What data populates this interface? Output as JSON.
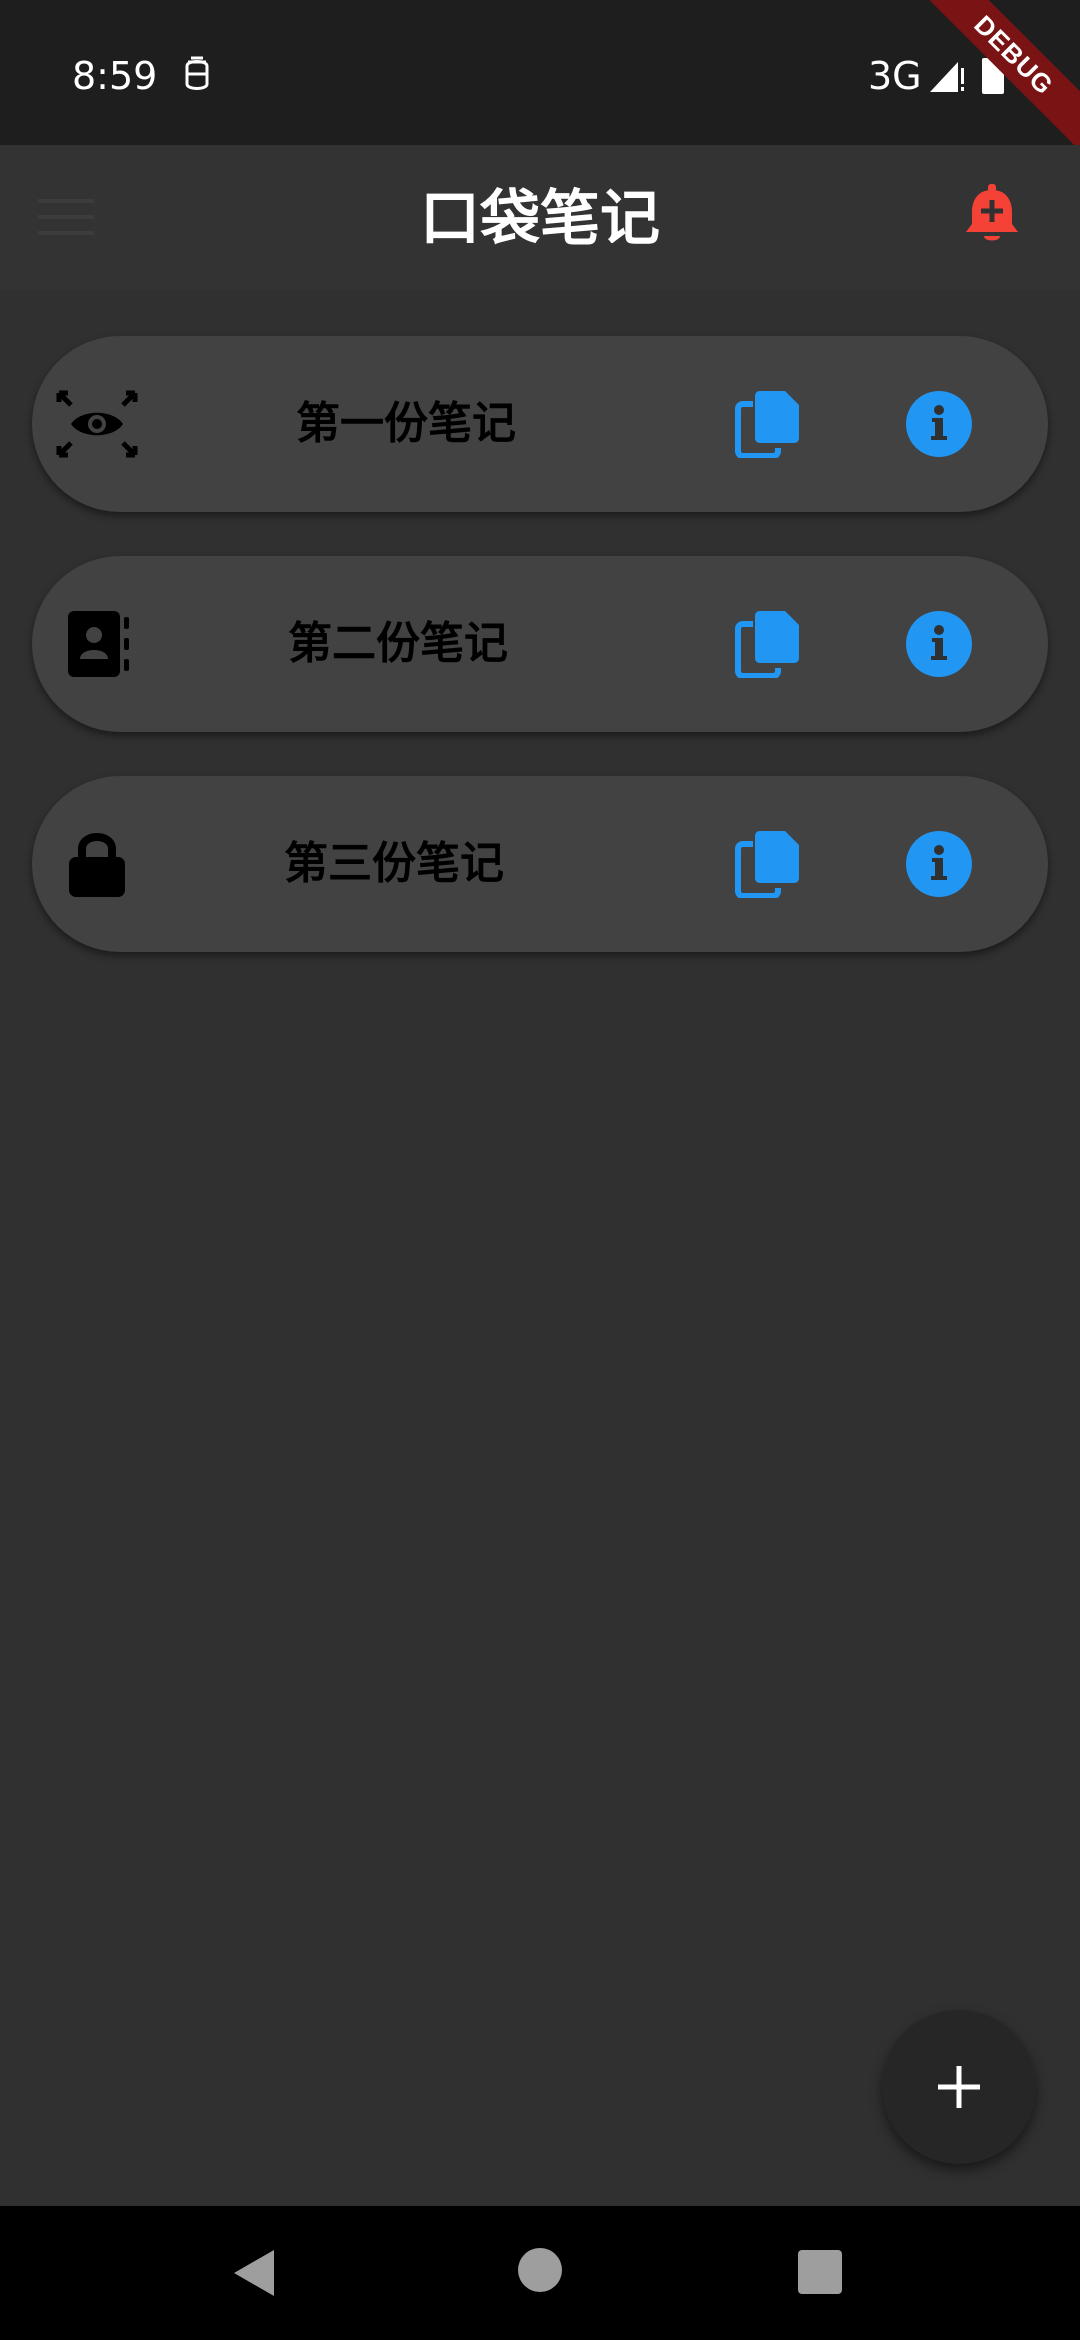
{
  "status_bar": {
    "time": "8:59",
    "network": "3G",
    "debug_label": "DEBUG"
  },
  "app_bar": {
    "title": "口袋笔记"
  },
  "notes": [
    {
      "title": "第一份笔记",
      "icon": "eye-focus-icon"
    },
    {
      "title": "第二份笔记",
      "icon": "contact-book-icon"
    },
    {
      "title": "第三份笔记",
      "icon": "lock-icon"
    }
  ],
  "colors": {
    "accent": "#2196f3",
    "bell": "#f44336",
    "background": "#303030",
    "card": "#424242"
  }
}
